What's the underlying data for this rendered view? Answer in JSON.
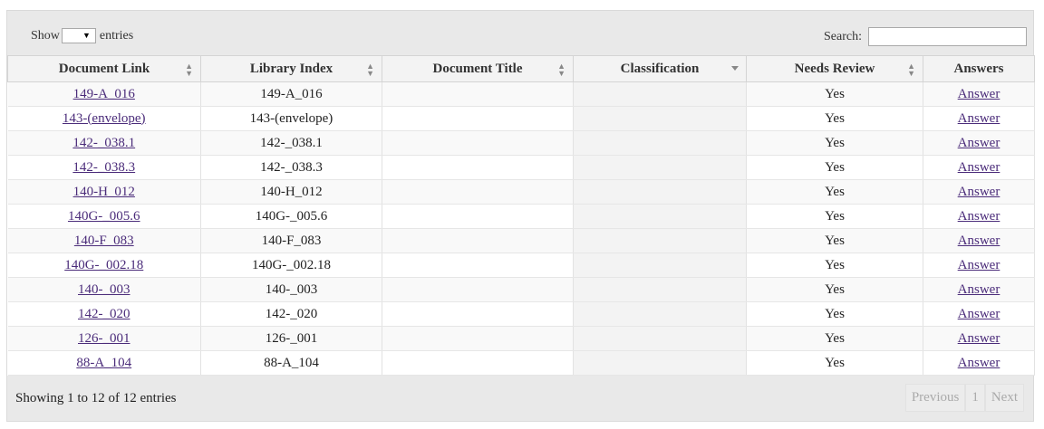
{
  "controls": {
    "show_label": "Show",
    "entries_label": "entries",
    "length_value": "",
    "search_label": "Search:",
    "search_value": ""
  },
  "table": {
    "columns": [
      "Document Link",
      "Library Index",
      "Document Title",
      "Classification",
      "Needs Review",
      "Answers"
    ],
    "rows": [
      {
        "link": "149-A_016",
        "index": "149-A_016",
        "title": "",
        "classification": "",
        "review": "Yes",
        "answer": "Answer"
      },
      {
        "link": "143-(envelope)",
        "index": "143-(envelope)",
        "title": "",
        "classification": "",
        "review": "Yes",
        "answer": "Answer"
      },
      {
        "link": "142-_038.1",
        "index": "142-_038.1",
        "title": "",
        "classification": "",
        "review": "Yes",
        "answer": "Answer"
      },
      {
        "link": "142-_038.3",
        "index": "142-_038.3",
        "title": "",
        "classification": "",
        "review": "Yes",
        "answer": "Answer"
      },
      {
        "link": "140-H_012",
        "index": "140-H_012",
        "title": "",
        "classification": "",
        "review": "Yes",
        "answer": "Answer"
      },
      {
        "link": "140G-_005.6",
        "index": "140G-_005.6",
        "title": "",
        "classification": "",
        "review": "Yes",
        "answer": "Answer"
      },
      {
        "link": "140-F_083",
        "index": "140-F_083",
        "title": "",
        "classification": "",
        "review": "Yes",
        "answer": "Answer"
      },
      {
        "link": "140G-_002.18",
        "index": "140G-_002.18",
        "title": "",
        "classification": "",
        "review": "Yes",
        "answer": "Answer"
      },
      {
        "link": "140-_003",
        "index": "140-_003",
        "title": "",
        "classification": "",
        "review": "Yes",
        "answer": "Answer"
      },
      {
        "link": "142-_020",
        "index": "142-_020",
        "title": "",
        "classification": "",
        "review": "Yes",
        "answer": "Answer"
      },
      {
        "link": "126-_001",
        "index": "126-_001",
        "title": "",
        "classification": "",
        "review": "Yes",
        "answer": "Answer"
      },
      {
        "link": "88-A_104",
        "index": "88-A_104",
        "title": "",
        "classification": "",
        "review": "Yes",
        "answer": "Answer"
      }
    ]
  },
  "footer": {
    "info": "Showing 1 to 12 of 12 entries",
    "previous": "Previous",
    "page": "1",
    "next": "Next"
  },
  "colors": {
    "link": "#4b2c7a",
    "panel": "#e9e9e9",
    "header_bg": "#f3f3f3"
  }
}
